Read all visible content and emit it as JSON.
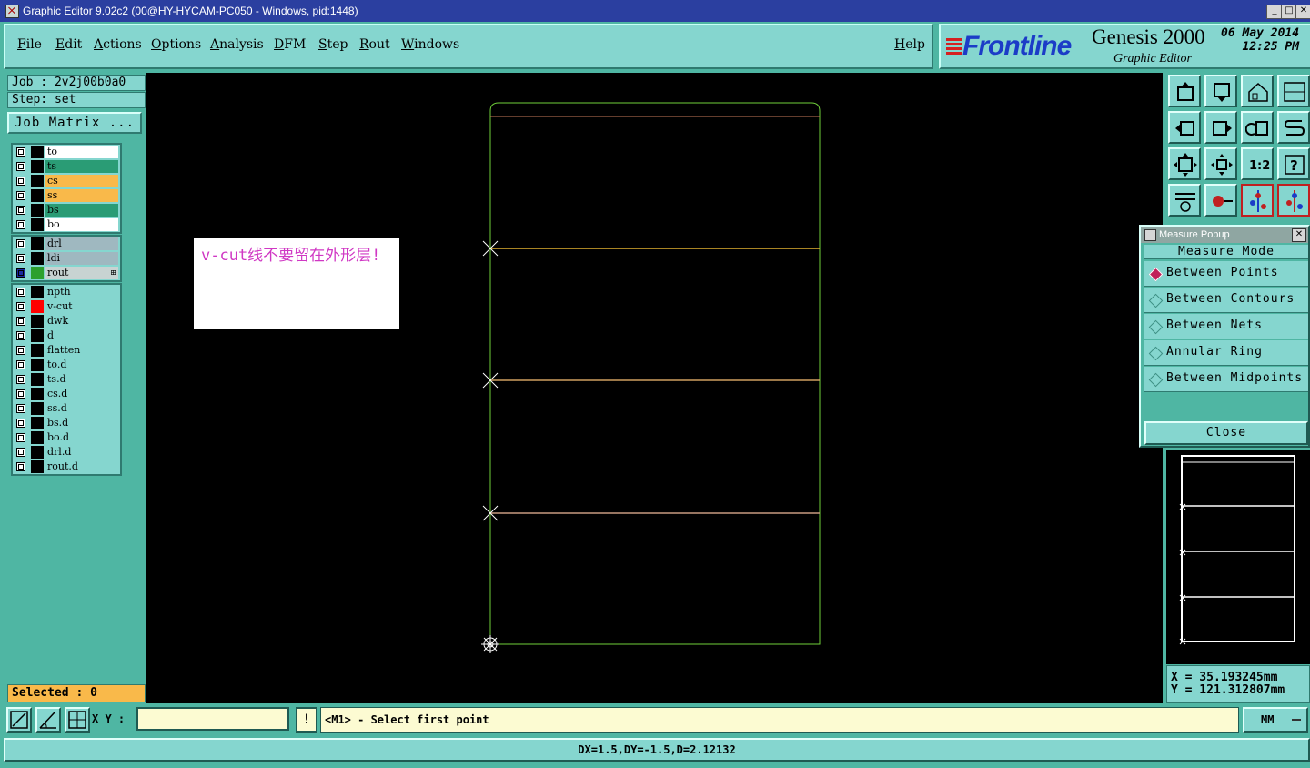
{
  "window": {
    "title": "Graphic Editor 9.02c2 (00@HY-HYCAM-PC050 - Windows, pid:1448)",
    "minimize": "_",
    "maximize": "□",
    "close": "✕"
  },
  "menu": {
    "items": [
      "File",
      "Edit",
      "Actions",
      "Options",
      "Analysis",
      "DFM",
      "Step",
      "Rout",
      "Windows"
    ],
    "help": "Help"
  },
  "brand": {
    "logo": "Frontline",
    "product": "Genesis 2000",
    "subtitle": "Graphic Editor",
    "date": "06 May 2014",
    "time": "12:25 PM",
    "accent": "#1b3cc7",
    "logo_mark_color": "#d62020"
  },
  "job": {
    "job_label": "Job : 2v2j00b0a0",
    "step_label": "Step: set",
    "matrix_button": "Job Matrix ..."
  },
  "layer_groups": [
    [
      {
        "name": "to",
        "color": "#ffffff",
        "swatch": "#000000"
      },
      {
        "name": "ts",
        "color": "#2a9c75",
        "swatch": "#000000"
      },
      {
        "name": "cs",
        "color": "#f9b94a",
        "swatch": "#000000"
      },
      {
        "name": "ss",
        "color": "#f9b94a",
        "swatch": "#000000"
      },
      {
        "name": "bs",
        "color": "#2a9c75",
        "swatch": "#000000"
      },
      {
        "name": "bo",
        "color": "#ffffff",
        "swatch": "#000000"
      }
    ],
    [
      {
        "name": "drl",
        "color": "#9fb8c0",
        "swatch": "#000000"
      },
      {
        "name": "ldi",
        "color": "#9fb8c0",
        "swatch": "#000000"
      },
      {
        "name": "rout",
        "color": "#c8d3d2",
        "swatch": "#2ca02c",
        "active": true,
        "mark": "⊞"
      }
    ],
    [
      {
        "name": "npth",
        "color": "#85d6cf",
        "swatch": "#000000"
      },
      {
        "name": "v-cut",
        "color": "#85d6cf",
        "swatch": "#ff0000"
      },
      {
        "name": "dwk",
        "color": "#85d6cf",
        "swatch": "#000000"
      },
      {
        "name": "d",
        "color": "#85d6cf",
        "swatch": "#000000"
      },
      {
        "name": "flatten",
        "color": "#85d6cf",
        "swatch": "#000000"
      },
      {
        "name": "to.d",
        "color": "#85d6cf",
        "swatch": "#000000"
      },
      {
        "name": "ts.d",
        "color": "#85d6cf",
        "swatch": "#000000"
      },
      {
        "name": "cs.d",
        "color": "#85d6cf",
        "swatch": "#000000"
      },
      {
        "name": "ss.d",
        "color": "#85d6cf",
        "swatch": "#000000"
      },
      {
        "name": "bs.d",
        "color": "#85d6cf",
        "swatch": "#000000"
      },
      {
        "name": "bo.d",
        "color": "#85d6cf",
        "swatch": "#000000"
      },
      {
        "name": "drl.d",
        "color": "#85d6cf",
        "swatch": "#000000"
      },
      {
        "name": "rout.d",
        "color": "#85d6cf",
        "swatch": "#000000"
      }
    ]
  ],
  "selected": "Selected : 0",
  "canvas": {
    "note": "v-cut线不要留在外形层!",
    "profile_color": "#6fcf3a",
    "vcut_color": "#e0b030"
  },
  "toolbar": {
    "icons": [
      "zoom-home-icon",
      "fit-screen-icon",
      "home-icon",
      "split-view-icon",
      "pan-left-icon",
      "pan-right-icon",
      "undo-view-icon",
      "redraw-icon",
      "zoom-extents-icon",
      "zoom-center-icon",
      "zoom-one-to-two-icon",
      "help-icon",
      "settings-icon",
      "snap-icon",
      "layers-color-icon",
      "layers-select-icon"
    ],
    "ratio_label": "1:2",
    "help_label": "?"
  },
  "measure_popup": {
    "title": "Measure Popup",
    "close_x": "✕",
    "mode_label": "Measure Mode",
    "options": [
      "Between Points",
      "Between Contours",
      "Between Nets",
      "Annular Ring",
      "Between Midpoints"
    ],
    "selected_index": 0,
    "close_button": "Close"
  },
  "coords": {
    "x": "X  =  35.193245mm",
    "y": "Y  =  121.312807mm"
  },
  "bottom": {
    "xy_label": "X Y :",
    "xy_value": "",
    "alert": "!",
    "prompt": "<M1> - Select first point",
    "units": "MM"
  },
  "status": "DX=1.5,DY=-1.5,D=2.12132"
}
